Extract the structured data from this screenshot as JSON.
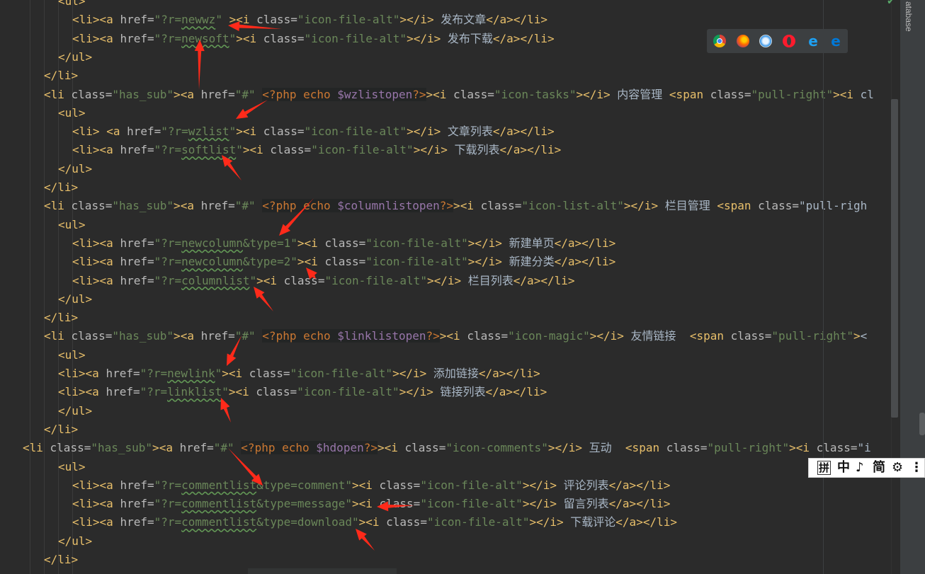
{
  "code_lines": [
    [
      "<ul>"
    ],
    [
      "<li><a href=\"?r=newwz\" ><i class=\"icon-file-alt\"></i> 发布文章</a></li>"
    ],
    [
      "<li><a href=\"?r=newsoft\"><i class=\"icon-file-alt\"></i> 发布下载</a></li>"
    ],
    [
      "</ul>"
    ],
    [
      "</li>"
    ],
    [
      "<li class=\"has_sub\"><a href=\"#\" ",
      "<?php echo $wzlistopen?>",
      "><i class=\"icon-tasks\"></i> 内容管理 <span class=\"pull-right\"><i cl"
    ],
    [
      "<ul>"
    ],
    [
      "<li> <a href=\"?r=wzlist\"><i class=\"icon-file-alt\"></i> 文章列表</a></li>"
    ],
    [
      "<li><a href=\"?r=softlist\"><i class=\"icon-file-alt\"></i> 下载列表</a></li>"
    ],
    [
      "</ul>"
    ],
    [
      "</li>"
    ],
    [
      "<li class=\"has_sub\"><a href=\"#\" ",
      "<?php echo $columnlistopen?>",
      "><i class=\"icon-list-alt\"></i> 栏目管理 <span class=\"pull-righ"
    ],
    [
      "<ul>"
    ],
    [
      "<li><a href=\"?r=newcolumn&type=1\"><i class=\"icon-file-alt\"></i> 新建单页</a></li>"
    ],
    [
      "<li><a href=\"?r=newcolumn&type=2\"><i class=\"icon-file-alt\"></i> 新建分类</a></li>"
    ],
    [
      "<li><a href=\"?r=columnlist\"><i class=\"icon-file-alt\"></i> 栏目列表</a></li>"
    ],
    [
      "</ul>"
    ],
    [
      "</li>"
    ],
    [
      "<li class=\"has_sub\"><a href=\"#\" ",
      "<?php echo $linklistopen?>",
      "><i class=\"icon-magic\"></i> 友情链接  <span class=\"pull-right\"><"
    ],
    [
      "<ul>"
    ],
    [
      "<li><a href=\"?r=newlink\"><i class=\"icon-file-alt\"></i> 添加链接</a></li>"
    ],
    [
      "<li><a href=\"?r=linklist\"><i class=\"icon-file-alt\"></i> 链接列表</a></li>"
    ],
    [
      "</ul>"
    ],
    [
      "</li>"
    ],
    [
      "<li class=\"has_sub\"><a href=\"#\" ",
      "<?php echo $hdopen?>",
      "><i class=\"icon-comments\"></i> 互动  <span class=\"pull-right\"><i class=\"i"
    ],
    [
      "<ul>"
    ],
    [
      "<li><a href=\"?r=commentlist&type=comment\"><i class=\"icon-file-alt\"></i> 评论列表</a></li>"
    ],
    [
      "<li><a href=\"?r=commentlist&type=message\"><i class=\"icon-file-alt\"></i> 留言列表</a></li>"
    ],
    [
      "<li><a href=\"?r=commentlist&type=download\"><i class=\"icon-file-alt\"></i> 下载评论</a></li>"
    ],
    [
      "</ul>"
    ],
    [
      "</li>"
    ]
  ],
  "sidebar": {
    "label": "atabase"
  },
  "browser_icons": [
    "chrome-icon",
    "firefox-icon",
    "safari-icon",
    "opera-icon",
    "ie-icon",
    "edge-icon"
  ],
  "ime_toolbar": {
    "items": [
      "拼",
      "中",
      "♪",
      "简",
      "⚙",
      "⋮"
    ]
  },
  "colors": {
    "background": "#2b2b2b",
    "tag": "#e8bf6a",
    "attribute": "#bababa",
    "string": "#6a8759",
    "text": "#a9b7c6",
    "php_keyword": "#cc7832",
    "php_variable": "#9876aa",
    "annotation_arrow": "#ff2a1a"
  }
}
